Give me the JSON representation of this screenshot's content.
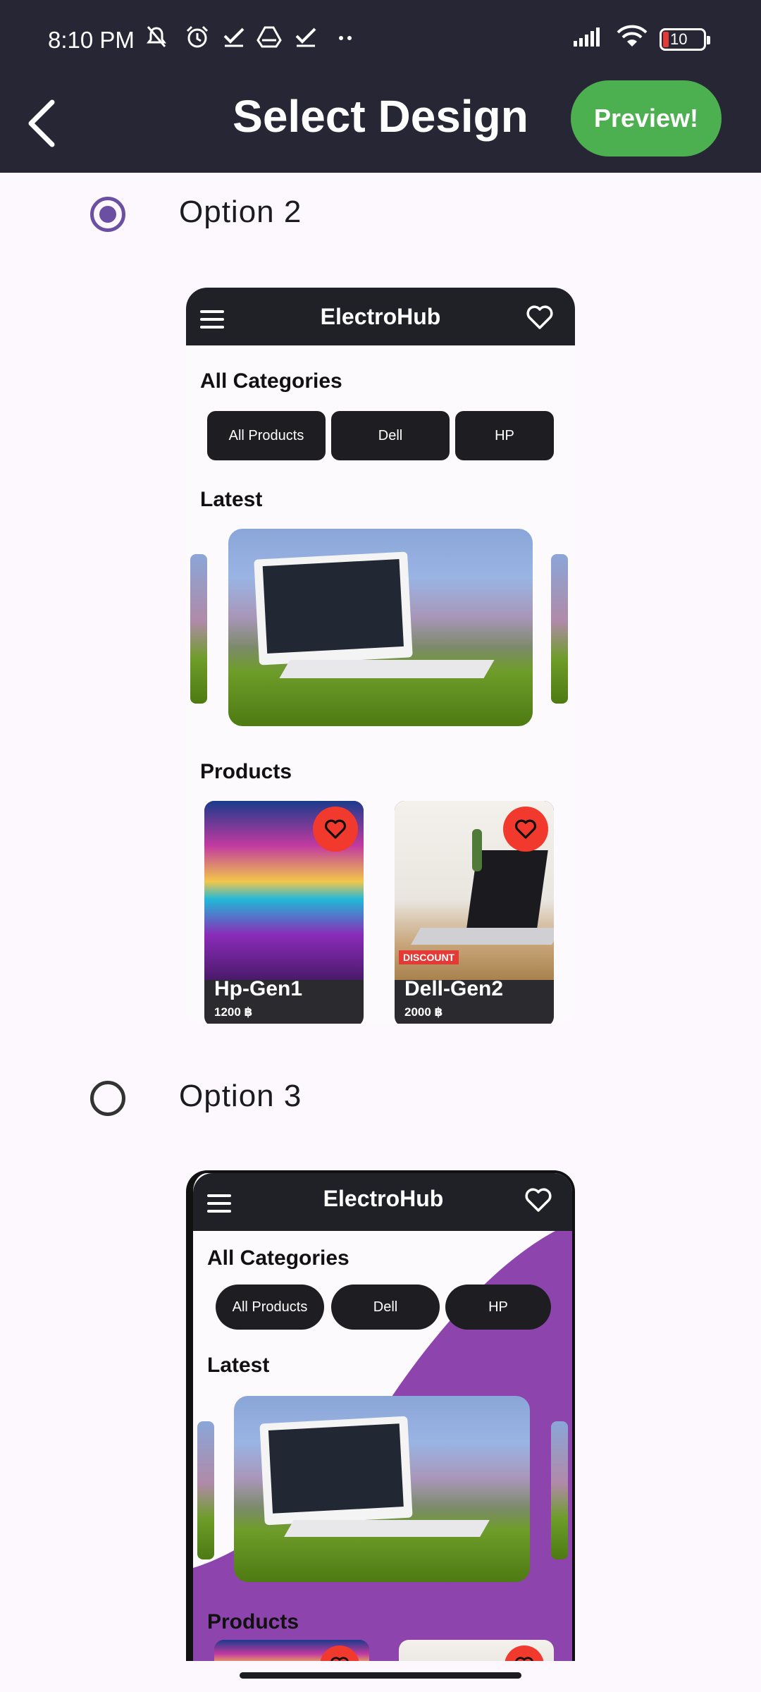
{
  "status_bar": {
    "time": "8:10 PM",
    "battery": "10",
    "left_icons": [
      "mute-icon",
      "alarm-icon",
      "check-icon",
      "drive-icon",
      "check-icon",
      "more-dots-icon"
    ],
    "right_icons": [
      "signal-icon",
      "wifi-icon",
      "battery-icon"
    ]
  },
  "app_bar": {
    "title": "Select Design",
    "preview_label": "Preview!",
    "back_icon": "back-arrow-icon"
  },
  "options": [
    {
      "label": "Option 2",
      "selected": true,
      "preview": {
        "app_title": "ElectroHub",
        "categories_heading": "All Categories",
        "chips": [
          "All Products",
          "Dell",
          "HP"
        ],
        "latest_heading": "Latest",
        "products_heading": "Products",
        "products": [
          {
            "name": "Hp-Gen1",
            "price": "1200 ฿",
            "discount": ""
          },
          {
            "name": "Dell-Gen2",
            "price": "2000 ฿",
            "discount": "DISCOUNT"
          }
        ]
      }
    },
    {
      "label": "Option 3",
      "selected": false,
      "preview": {
        "app_title": "ElectroHub",
        "categories_heading": "All Categories",
        "chips": [
          "All Products",
          "Dell",
          "HP"
        ],
        "latest_heading": "Latest",
        "products_heading": "Products"
      }
    }
  ],
  "colors": {
    "app_bar_bg": "#272635",
    "preview_button": "#4caf50",
    "radio_selected": "#6b4fa3",
    "option3_accent": "#8e44ad",
    "heart_bubble": "#f2392d"
  }
}
